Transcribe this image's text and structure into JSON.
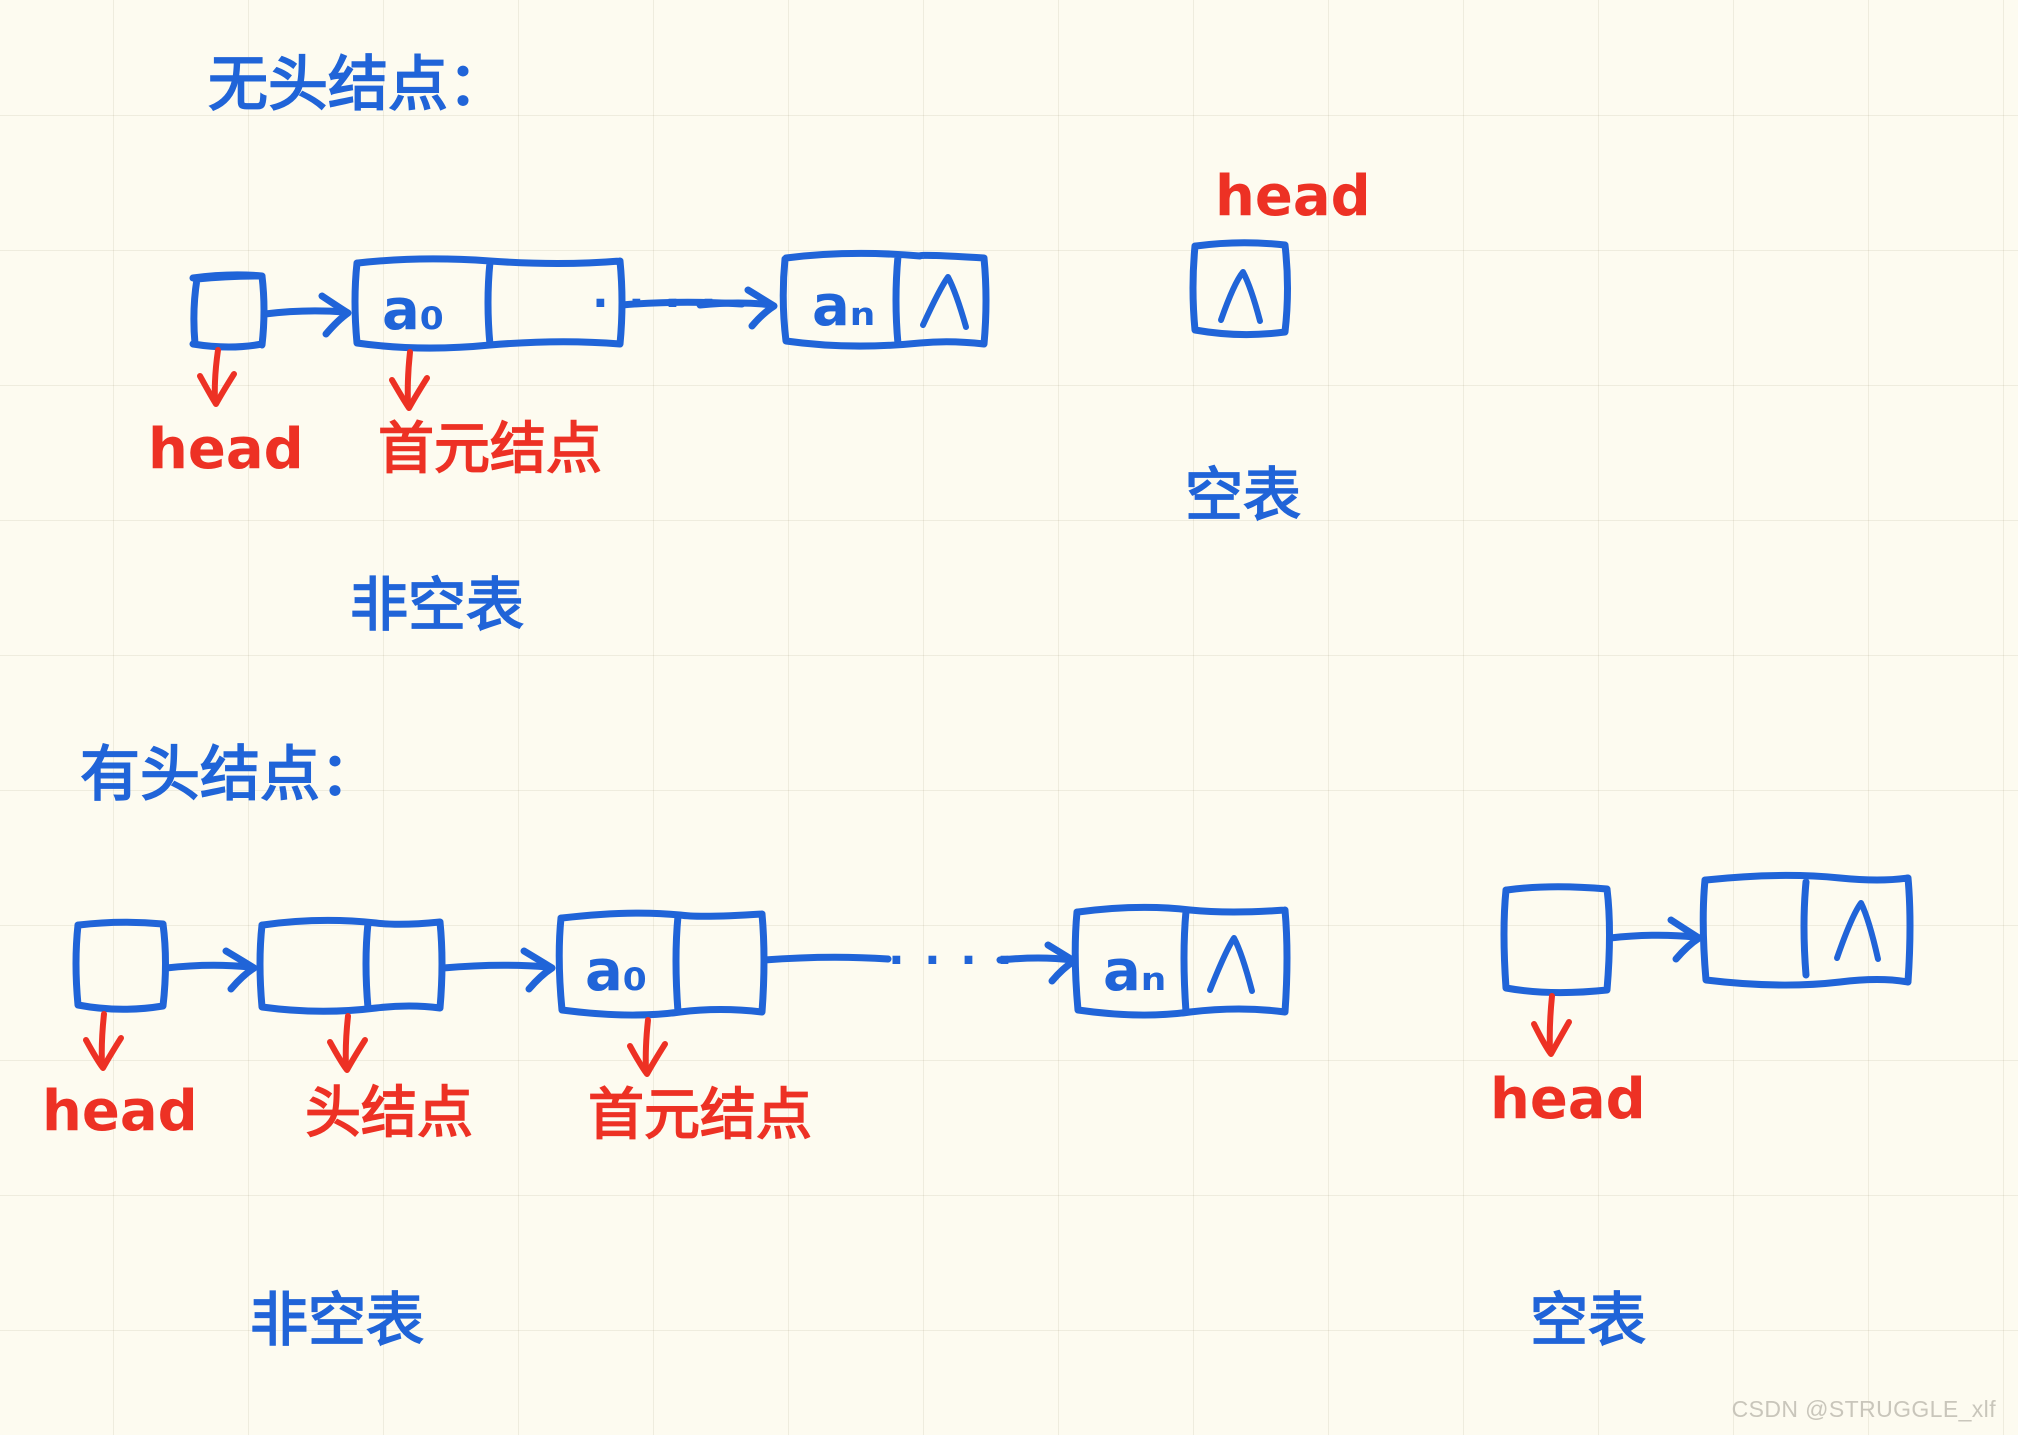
{
  "page": {
    "background_color": "#fdfbf0",
    "ink_blue": "#2064d8",
    "ink_red": "#ed3124",
    "watermark": "CSDN @STRUGGLE_xlf"
  },
  "sections": [
    {
      "id": "no-head-node",
      "title": "无头结点：",
      "diagrams": [
        {
          "id": "non-empty-list-1",
          "caption": "非空表",
          "pointer_box": {
            "value": "",
            "label": "head"
          },
          "nodes": [
            {
              "data": "a₀",
              "next": "",
              "label": "首元结点"
            },
            {
              "data": "aₙ",
              "next": "∧",
              "label": ""
            }
          ],
          "ellipsis": "· · · ·"
        },
        {
          "id": "empty-list-1",
          "caption": "空表",
          "pointer_box": {
            "value": "∧",
            "label": "head"
          },
          "nodes": [],
          "ellipsis": ""
        }
      ]
    },
    {
      "id": "with-head-node",
      "title": "有头结点：",
      "diagrams": [
        {
          "id": "non-empty-list-2",
          "caption": "非空表",
          "pointer_box": {
            "value": "",
            "label": "head"
          },
          "nodes": [
            {
              "data": "",
              "next": "",
              "label": "头结点"
            },
            {
              "data": "a₀",
              "next": "",
              "label": "首元结点"
            },
            {
              "data": "aₙ",
              "next": "∧",
              "label": ""
            }
          ],
          "ellipsis": "· · · ·"
        },
        {
          "id": "empty-list-2",
          "caption": "空表",
          "pointer_box": {
            "value": "",
            "label": "head"
          },
          "nodes": [
            {
              "data": "",
              "next": "∧",
              "label": ""
            }
          ],
          "ellipsis": ""
        }
      ]
    }
  ],
  "labels": {
    "head": "head",
    "head_node": "头结点",
    "first_element_node": "首元结点",
    "empty_list": "空表",
    "non_empty_list": "非空表",
    "null_symbol": "∧",
    "a0": "a₀",
    "an": "aₙ",
    "ellipsis": "· · · ·",
    "title_no_head": "无头结点：",
    "title_with_head": "有头结点："
  }
}
